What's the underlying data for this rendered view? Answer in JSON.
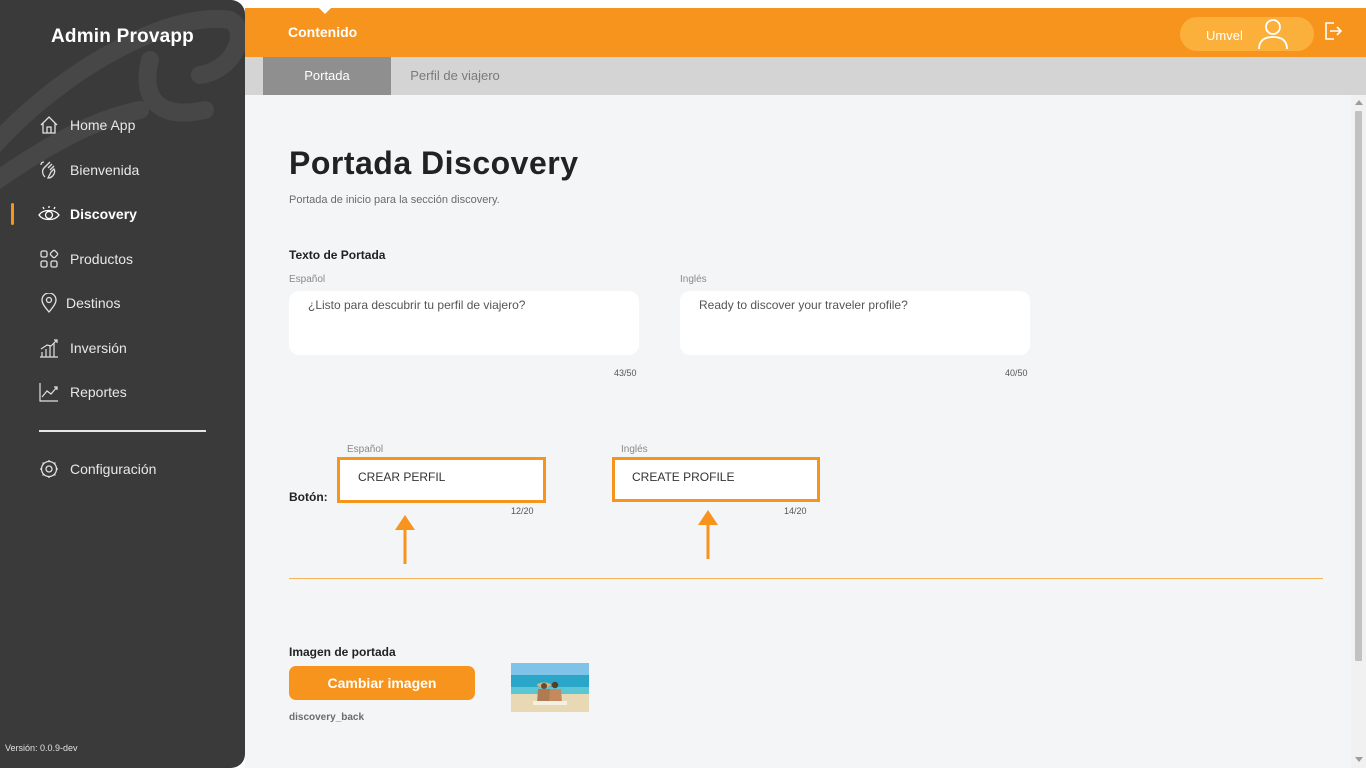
{
  "app": {
    "title": "Admin Provapp",
    "version": "Versión: 0.0.9-dev"
  },
  "sidebar": {
    "items": [
      {
        "label": "Home App",
        "icon": "home-icon"
      },
      {
        "label": "Bienvenida",
        "icon": "waving-hand-icon"
      },
      {
        "label": "Discovery",
        "icon": "eye-icon",
        "active": true
      },
      {
        "label": "Productos",
        "icon": "grid-icon"
      },
      {
        "label": "Destinos",
        "icon": "location-pin-icon"
      },
      {
        "label": "Inversión",
        "icon": "bar-chart-icon"
      },
      {
        "label": "Reportes",
        "icon": "line-chart-icon"
      }
    ],
    "settings": {
      "label": "Configuración",
      "icon": "gear-icon"
    }
  },
  "header": {
    "section": "Contenido",
    "user": "Umvel",
    "tabs": [
      {
        "label": "Portada",
        "active": true
      },
      {
        "label": "Perfil de viajero",
        "active": false
      }
    ]
  },
  "page": {
    "title": "Portada Discovery",
    "subtitle": "Portada de inicio para la sección discovery.",
    "texto_portada": {
      "heading": "Texto de Portada",
      "es": {
        "label": "Español",
        "value": "¿Listo para descubrir tu perfil de viajero?",
        "counter": "43/50"
      },
      "en": {
        "label": "Inglés",
        "value": "Ready to discover your traveler profile?",
        "counter": "40/50"
      }
    },
    "boton": {
      "heading": "Botón:",
      "es": {
        "label": "Español",
        "value": "CREAR PERFIL",
        "counter": "12/20"
      },
      "en": {
        "label": "Inglés",
        "value": "CREATE PROFILE",
        "counter": "14/20"
      }
    },
    "imagen": {
      "heading": "Imagen de portada",
      "button": "Cambiar imagen",
      "file": "discovery_back"
    }
  },
  "colors": {
    "accent": "#f7941d",
    "sidebar": "#3a3a3a",
    "pill": "#fbb03b",
    "tabs": "#d4d4d4"
  }
}
